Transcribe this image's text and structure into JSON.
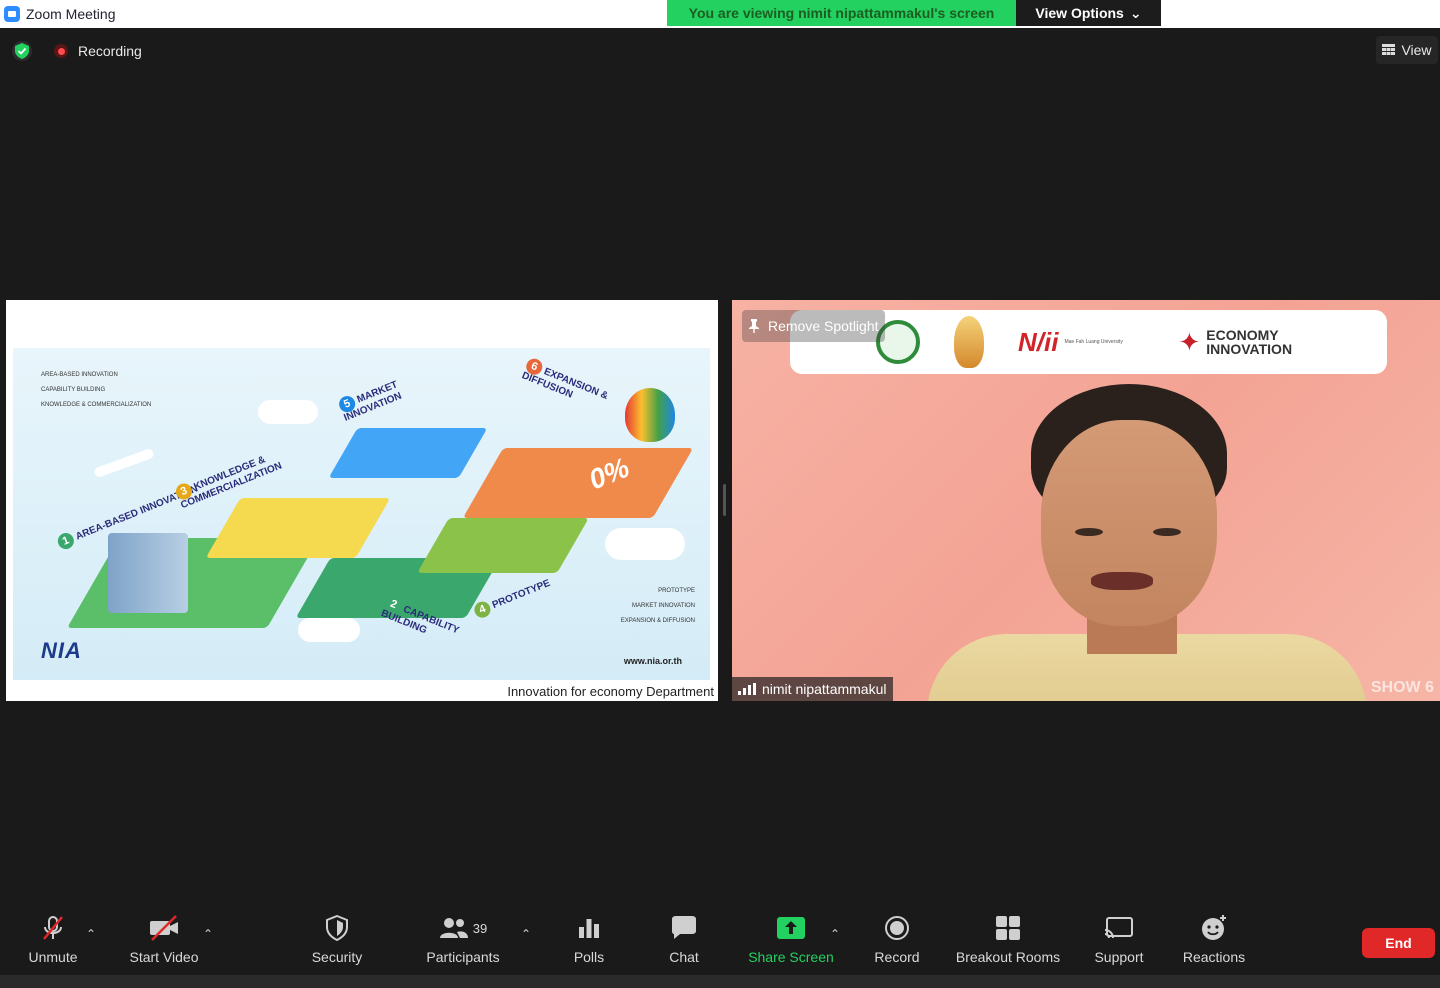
{
  "window": {
    "title": "Zoom Meeting"
  },
  "banner": {
    "viewing_text": "You are viewing nimit nipattammakul's screen",
    "view_options_label": "View Options"
  },
  "status": {
    "recording_label": "Recording",
    "view_label": "View"
  },
  "share": {
    "caption": "Innovation for economy Department",
    "slide": {
      "url": "www.nia.or.th",
      "logo": "NIA",
      "steps": [
        {
          "num": "1",
          "label": "AREA-BASED INNOVATION"
        },
        {
          "num": "2",
          "label": "CAPABILITY BUILDING"
        },
        {
          "num": "3",
          "label": "KNOWLEDGE & COMMERCIALIZATION"
        },
        {
          "num": "4",
          "label": "PROTOTYPE"
        },
        {
          "num": "5",
          "label": "MARKET INNOVATION"
        },
        {
          "num": "6",
          "label": "EXPANSION & DIFFUSION"
        }
      ],
      "interest": "0%",
      "legend_top": [
        "AREA-BASED INNOVATION",
        "CAPABILITY BUILDING",
        "KNOWLEDGE & COMMERCIALIZATION"
      ],
      "legend_bottom": [
        "PROTOTYPE",
        "MARKET INNOVATION",
        "EXPANSION & DIFFUSION"
      ]
    }
  },
  "camera": {
    "participant_name": "nimit nipattammakul",
    "remove_spotlight_label": "Remove Spotlight",
    "logos": {
      "nii": "N/ii",
      "mfu": "Mae Fah Luang University",
      "economy": "ECONOMY",
      "innovation": "INNOVATION"
    },
    "watermark": "SHOW 6"
  },
  "toolbar": {
    "unmute": "Unmute",
    "start_video": "Start Video",
    "security": "Security",
    "participants": "Participants",
    "participants_count": "39",
    "polls": "Polls",
    "chat": "Chat",
    "share_screen": "Share Screen",
    "record": "Record",
    "breakout_rooms": "Breakout Rooms",
    "support": "Support",
    "reactions": "Reactions",
    "end": "End"
  },
  "colors": {
    "share_green": "#23d160",
    "end_red": "#e02828",
    "cam_bg": "#f3a394"
  }
}
